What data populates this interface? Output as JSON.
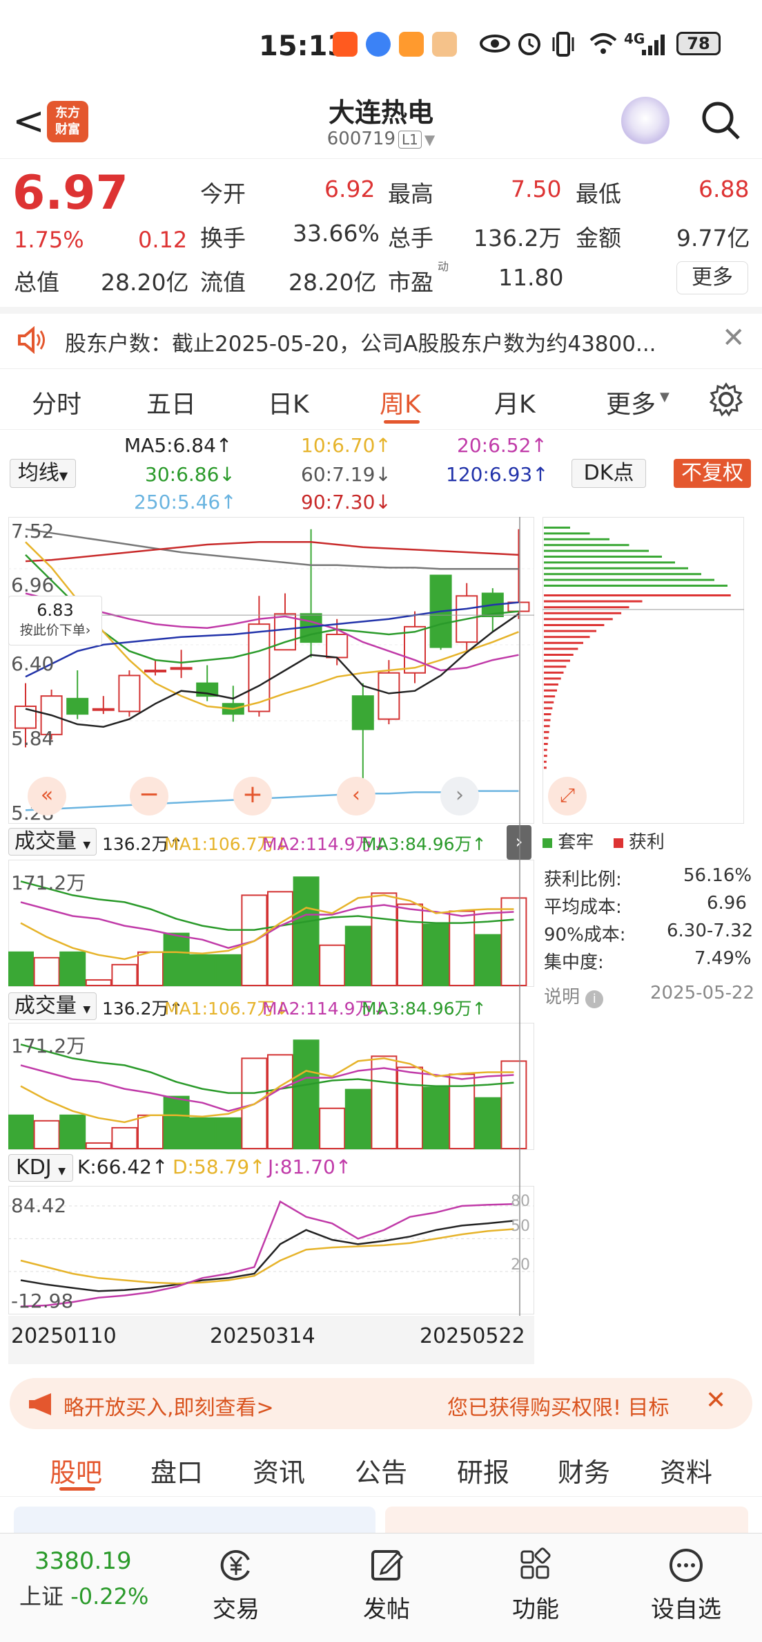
{
  "status_bar": {
    "time": "15:13",
    "network": "4G",
    "battery": "78"
  },
  "header": {
    "back": "<",
    "logo_text": "东方\n财富",
    "title": "大连热电",
    "code": "600719",
    "level": "L1"
  },
  "quote": {
    "price": "6.97",
    "pct": "1.75%",
    "change": "0.12",
    "open_label": "今开",
    "open": "6.92",
    "high_label": "最高",
    "high": "7.50",
    "low_label": "最低",
    "low": "6.88",
    "turnover_label": "换手",
    "turnover": "33.66%",
    "volume_label": "总手",
    "volume": "136.2万",
    "amount_label": "金额",
    "amount": "9.77亿",
    "total_val_label": "总值",
    "total_val": "28.20亿",
    "float_val_label": "流值",
    "float_val": "28.20亿",
    "pe_label": "市盈",
    "pe_sup": "动",
    "pe": "11.80",
    "more": "更多"
  },
  "notice": {
    "text": "股东户数：截止2025-05-20，公司A股股东户数为约43800..."
  },
  "ktabs": [
    "分时",
    "五日",
    "日K",
    "周K",
    "月K",
    "更多"
  ],
  "ktab_active": 3,
  "ma": {
    "ma5": "MA5:6.84↑",
    "ma10": "10:6.70↑",
    "ma20": "20:6.52↑",
    "ma30": "30:6.86↓",
    "ma60": "60:7.19↓",
    "ma120": "120:6.93↑",
    "ma250": "250:5.46↑",
    "ma90": "90:7.30↓",
    "selector": "均线",
    "dk": "DK点",
    "fq": "不复权"
  },
  "kchart": {
    "axis": [
      "7.52",
      "6.96",
      "6.40",
      "5.84",
      "5.28"
    ],
    "price_tag": "6.83",
    "price_tag_sub": "按此价下单",
    "candles": [
      {
        "o": 5.95,
        "c": 6.12,
        "h": 6.3,
        "l": 5.8
      },
      {
        "o": 5.9,
        "c": 6.2,
        "h": 6.25,
        "l": 5.86
      },
      {
        "o": 6.18,
        "c": 6.06,
        "h": 6.4,
        "l": 6.02
      },
      {
        "o": 6.1,
        "c": 6.1,
        "h": 6.2,
        "l": 6.06
      },
      {
        "o": 6.08,
        "c": 6.36,
        "h": 6.4,
        "l": 6.04
      },
      {
        "o": 6.4,
        "c": 6.4,
        "h": 6.48,
        "l": 6.36
      },
      {
        "o": 6.42,
        "c": 6.42,
        "h": 6.56,
        "l": 6.34
      },
      {
        "o": 6.3,
        "c": 6.2,
        "h": 6.44,
        "l": 6.16
      },
      {
        "o": 6.14,
        "c": 6.06,
        "h": 6.28,
        "l": 6.0
      },
      {
        "o": 6.08,
        "c": 6.76,
        "h": 6.98,
        "l": 6.04
      },
      {
        "o": 6.56,
        "c": 6.84,
        "h": 7.0,
        "l": 6.56
      },
      {
        "o": 6.84,
        "c": 6.62,
        "h": 7.5,
        "l": 6.5
      },
      {
        "o": 6.5,
        "c": 6.68,
        "h": 6.8,
        "l": 6.44
      },
      {
        "o": 6.2,
        "c": 5.94,
        "h": 6.3,
        "l": 5.34
      },
      {
        "o": 6.02,
        "c": 6.38,
        "h": 6.48,
        "l": 5.98
      },
      {
        "o": 6.38,
        "c": 6.74,
        "h": 6.86,
        "l": 6.3
      },
      {
        "o": 7.14,
        "c": 6.58,
        "h": 7.14,
        "l": 6.56
      },
      {
        "o": 6.62,
        "c": 6.98,
        "h": 7.08,
        "l": 6.54
      },
      {
        "o": 7.0,
        "c": 6.82,
        "h": 7.04,
        "l": 6.7
      },
      {
        "o": 6.86,
        "c": 6.93,
        "h": 7.5,
        "l": 6.8
      }
    ]
  },
  "volume": {
    "label": "成交量",
    "vol": "136.2万↑",
    "ma1": "MA1:106.7万↓",
    "ma2": "MA2:114.9万↓",
    "ma3": "MA3:84.96万↑",
    "axis_max": "171.2万",
    "bars": [
      {
        "v": 48,
        "up": false
      },
      {
        "v": 40,
        "up": true
      },
      {
        "v": 48,
        "up": false
      },
      {
        "v": 8,
        "up": true
      },
      {
        "v": 30,
        "up": true
      },
      {
        "v": 48,
        "up": true
      },
      {
        "v": 75,
        "up": false
      },
      {
        "v": 44,
        "up": false
      },
      {
        "v": 44,
        "up": false
      },
      {
        "v": 130,
        "up": true
      },
      {
        "v": 135,
        "up": true
      },
      {
        "v": 156,
        "up": false
      },
      {
        "v": 58,
        "up": true
      },
      {
        "v": 85,
        "up": false
      },
      {
        "v": 133,
        "up": true
      },
      {
        "v": 117,
        "up": true
      },
      {
        "v": 88,
        "up": false
      },
      {
        "v": 107,
        "up": true
      },
      {
        "v": 73,
        "up": false
      },
      {
        "v": 126,
        "up": true
      }
    ]
  },
  "kdj": {
    "label": "KDJ",
    "k": "K:66.42↑",
    "d": "D:58.79↑",
    "j": "J:81.70↑",
    "top": "84.42",
    "bottom": "-12.98",
    "r80": "80",
    "r50": "50",
    "r20": "20"
  },
  "dates": [
    "20250110",
    "20250314",
    "20250522"
  ],
  "chips": {
    "legend_trap": "套牢",
    "legend_profit": "获利",
    "rows": [
      {
        "k": "获利比例:",
        "v": "56.16%"
      },
      {
        "k": "平均成本:",
        "v": "6.96"
      },
      {
        "k": "90%成本:",
        "v": "6.30-7.32"
      },
      {
        "k": "集中度:",
        "v": "7.49%"
      }
    ],
    "note": "说明",
    "date": "2025-05-22"
  },
  "banner": {
    "left": "略开放买入,即刻查看>",
    "right": "您已获得购买权限! 目标"
  },
  "btabs": [
    "股吧",
    "盘口",
    "资讯",
    "公告",
    "研报",
    "财务",
    "资料"
  ],
  "btab_active": 0,
  "bnav": {
    "index_value": "3380.19",
    "index_name": "上证",
    "index_pct": "-0.22%",
    "trade": "交易",
    "post": "发帖",
    "func": "功能",
    "watch": "设自选"
  },
  "colors": {
    "up": "#d33333",
    "down": "#3aa835",
    "accent": "#e4572e"
  }
}
